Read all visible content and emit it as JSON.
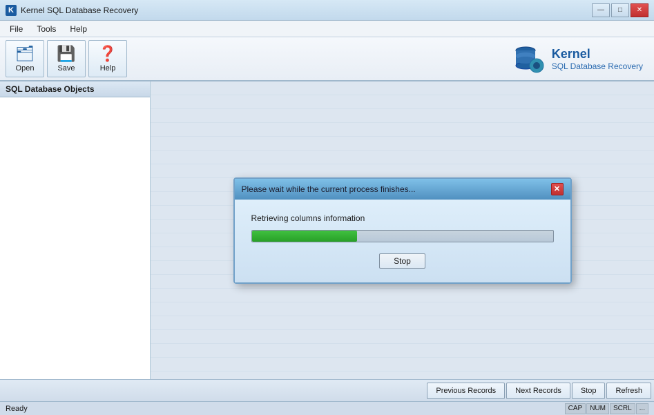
{
  "window": {
    "title": "Kernel SQL Database Recovery",
    "icon": "K"
  },
  "title_controls": {
    "minimize": "—",
    "maximize": "□",
    "close": "✕"
  },
  "menu": {
    "items": [
      "File",
      "Tools",
      "Help"
    ]
  },
  "toolbar": {
    "buttons": [
      {
        "label": "Open",
        "icon": "🗂"
      },
      {
        "label": "Save",
        "icon": "💾"
      },
      {
        "label": "Help",
        "icon": "❓"
      }
    ]
  },
  "brand": {
    "name": "Kernel",
    "subtitle": "SQL Database Recovery"
  },
  "left_panel": {
    "header": "SQL Database Objects"
  },
  "bottom_toolbar": {
    "previous_records": "Previous Records",
    "next_records": "Next Records",
    "stop": "Stop",
    "refresh": "Refresh"
  },
  "status_bar": {
    "status": "Ready",
    "indicators": [
      "CAP",
      "NUM",
      "SCRL",
      "..."
    ]
  },
  "modal": {
    "title": "Please wait while the current process finishes...",
    "status_text": "Retrieving columns information",
    "progress_percent": 35,
    "stop_button": "Stop",
    "close_btn": "✕"
  }
}
